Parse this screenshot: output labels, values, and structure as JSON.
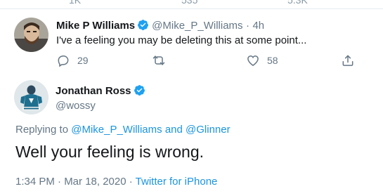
{
  "reply": {
    "name": "Mike P Williams",
    "handle": "@Mike_P_Williams",
    "separator": "·",
    "time": "4h",
    "text": "I've a feeling you may be deleting this at some point...",
    "counts": {
      "replies": "29",
      "likes": "58"
    }
  },
  "tweet": {
    "name": "Jonathan Ross",
    "handle": "@wossy",
    "replying_prefix": "Replying to",
    "replying_user1": "@Mike_P_Williams",
    "replying_and": "and",
    "replying_user2": "@Glinner",
    "text": "Well your feeling is wrong.",
    "timestamp": "1:34 PM · Mar 18, 2020 ·",
    "source": "Twitter for iPhone"
  },
  "colors": {
    "accent": "#1da1f2",
    "link": "#1b95e0",
    "muted": "#657786"
  },
  "icons": [
    "verified-badge-icon",
    "reply-icon",
    "retweet-icon",
    "like-icon",
    "share-icon"
  ]
}
